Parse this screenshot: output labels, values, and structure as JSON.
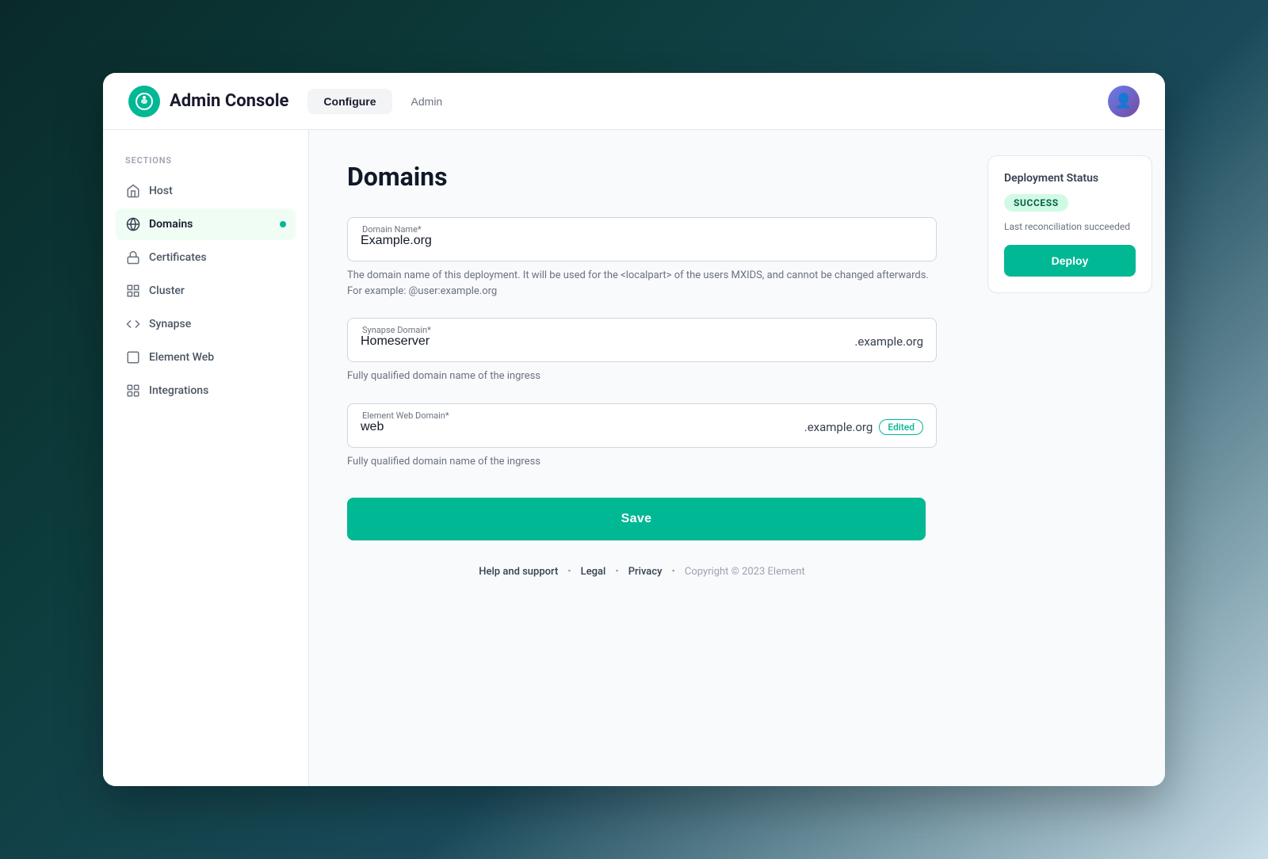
{
  "header": {
    "title": "Admin Console",
    "tabs": [
      {
        "id": "configure",
        "label": "Configure",
        "active": true
      },
      {
        "id": "admin",
        "label": "Admin",
        "active": false
      }
    ]
  },
  "sidebar": {
    "sections_label": "SECTIONS",
    "items": [
      {
        "id": "host",
        "label": "Host",
        "icon": "home",
        "active": false
      },
      {
        "id": "domains",
        "label": "Domains",
        "icon": "globe",
        "active": true,
        "has_dot": true
      },
      {
        "id": "certificates",
        "label": "Certificates",
        "icon": "lock",
        "active": false
      },
      {
        "id": "cluster",
        "label": "Cluster",
        "icon": "grid",
        "active": false
      },
      {
        "id": "synapse",
        "label": "Synapse",
        "icon": "code",
        "active": false
      },
      {
        "id": "element-web",
        "label": "Element Web",
        "icon": "square",
        "active": false
      },
      {
        "id": "integrations",
        "label": "Integrations",
        "icon": "grid4",
        "active": false
      }
    ]
  },
  "page": {
    "title": "Domains",
    "fields": {
      "domain_name": {
        "label": "Domain Name*",
        "value": "Example.org",
        "hint": "The domain name of this deployment. It will be used for the <localpart> of the users MXIDS, and cannot be changed afterwards. For example: @user:example.org"
      },
      "synapse_domain": {
        "label": "Synapse Domain*",
        "value": "Homeserver",
        "suffix": ".example.org",
        "hint": "Fully qualified domain name of the ingress"
      },
      "element_web_domain": {
        "label": "Element Web Domain*",
        "value": "web",
        "suffix": ".example.org",
        "badge": "Edited",
        "hint": "Fully qualified domain name of the ingress"
      }
    },
    "save_button": "Save"
  },
  "deployment": {
    "title": "Deployment Status",
    "status": "SUCCESS",
    "reconciliation_text": "Last reconciliation succeeded",
    "deploy_button": "Deploy"
  },
  "footer": {
    "links": [
      {
        "label": "Help and support"
      },
      {
        "label": "Legal"
      },
      {
        "label": "Privacy"
      }
    ],
    "copyright": "Copyright © 2023 Element"
  }
}
